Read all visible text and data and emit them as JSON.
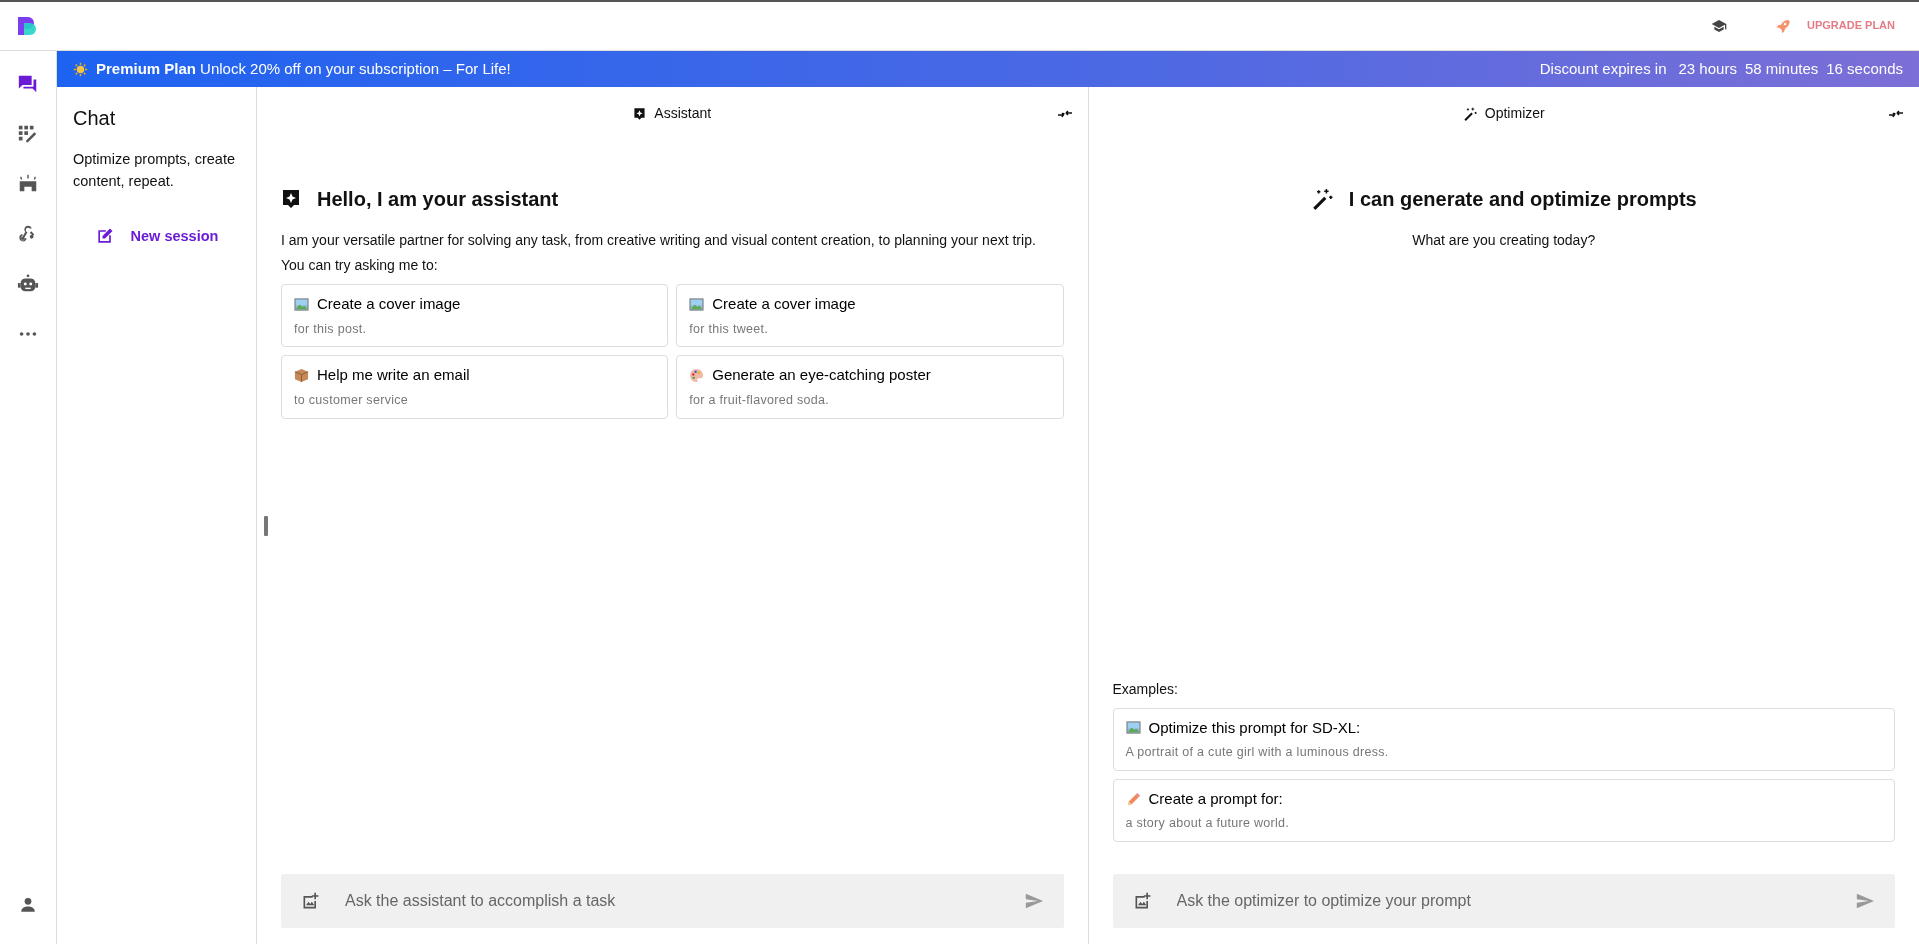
{
  "topbar": {
    "upgrade_label": "UPGRADE PLAN"
  },
  "rail": [
    {
      "kind": "chat",
      "selected": true
    },
    {
      "kind": "grid",
      "selected": false
    },
    {
      "kind": "store",
      "selected": false
    },
    {
      "kind": "webhook",
      "selected": false
    },
    {
      "kind": "robot",
      "selected": false
    },
    {
      "kind": "more",
      "selected": false
    }
  ],
  "banner": {
    "plan": "Premium Plan",
    "offer": "Unlock 20% off on your subscription – For Life!",
    "expires_label": "Discount expires in",
    "countdown": [
      "23 hours",
      "58 minutes",
      "16 seconds"
    ]
  },
  "sidebar": {
    "title": "Chat",
    "description": "Optimize prompts, create content, repeat.",
    "new_session": "New session"
  },
  "assistant": {
    "header": "Assistant",
    "greeting": "Hello, I am your assistant",
    "intro": "I am your versatile partner for solving any task, from creative writing and visual content creation, to planning your next trip.",
    "try_label": "You can try asking me to:",
    "suggestions": [
      {
        "kind": "picture",
        "title": "Create a cover image",
        "subtitle": "for this post."
      },
      {
        "kind": "picture",
        "title": "Create a cover image",
        "subtitle": "for this tweet."
      },
      {
        "kind": "package",
        "title": "Help me write an email",
        "subtitle": "to customer service"
      },
      {
        "kind": "palette",
        "title": "Generate an eye-catching poster",
        "subtitle": "for a fruit-flavored soda."
      }
    ],
    "input": {
      "placeholder": "Ask the assistant to accomplish a task"
    }
  },
  "optimizer": {
    "header": "Optimizer",
    "heading": "I can generate and optimize prompts",
    "subtitle": "What are you creating today?",
    "examples_label": "Examples:",
    "examples": [
      {
        "kind": "picture",
        "title": "Optimize this prompt for SD-XL:",
        "subtitle": "A portrait of a cute girl with a luminous dress."
      },
      {
        "kind": "pencil",
        "title": "Create a prompt for:",
        "subtitle": "a story about a future world."
      }
    ],
    "input": {
      "placeholder": "Ask the optimizer to optimize your prompt"
    }
  }
}
